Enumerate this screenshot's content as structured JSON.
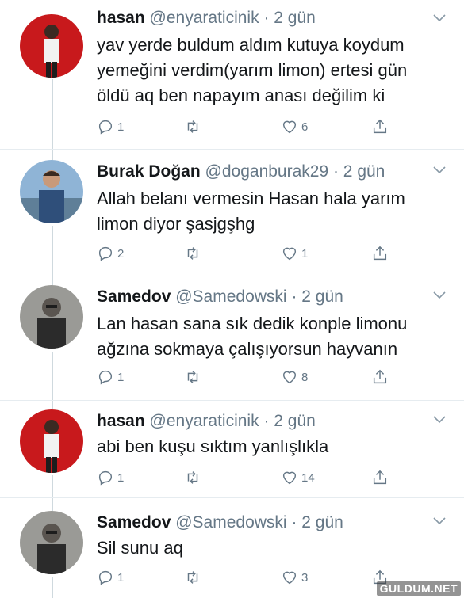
{
  "tweets": [
    {
      "name": "hasan",
      "handle": "@enyaraticinik",
      "time": "· 2 gün",
      "text": "yav yerde buldum aldım kutuya koydum yemeğini verdim(yarım limon) ertesi gün öldü aq ben napayım anası değilim ki",
      "replies": "1",
      "retweets": "",
      "likes": "6"
    },
    {
      "name": "Burak Doğan",
      "handle": "@doganburak29",
      "time": "· 2 gün",
      "text": "Allah belanı vermesin Hasan hala yarım limon diyor şasjgşhg",
      "replies": "2",
      "retweets": "",
      "likes": "1"
    },
    {
      "name": "Samedov",
      "handle": "@Samedowski",
      "time": "· 2 gün",
      "text": "Lan hasan sana sık dedik konple limonu ağzına sokmaya çalışıyorsun hayvanın",
      "replies": "1",
      "retweets": "",
      "likes": "8"
    },
    {
      "name": "hasan",
      "handle": "@enyaraticinik",
      "time": "· 2 gün",
      "text": "abi ben kuşu sıktım yanlışlıkla",
      "replies": "1",
      "retweets": "",
      "likes": "14"
    },
    {
      "name": "Samedov",
      "handle": "@Samedowski",
      "time": "· 2 gün",
      "text": "Sil sunu aq",
      "replies": "1",
      "retweets": "",
      "likes": "3"
    }
  ],
  "icons": {
    "reply": "reply-icon",
    "retweet": "retweet-icon",
    "like": "heart-icon",
    "share": "share-icon",
    "menu": "chevron-down-icon"
  },
  "watermark": "GULDUM.NET",
  "colors": {
    "text": "#14171a",
    "muted": "#657786",
    "line": "#cfd9de"
  }
}
